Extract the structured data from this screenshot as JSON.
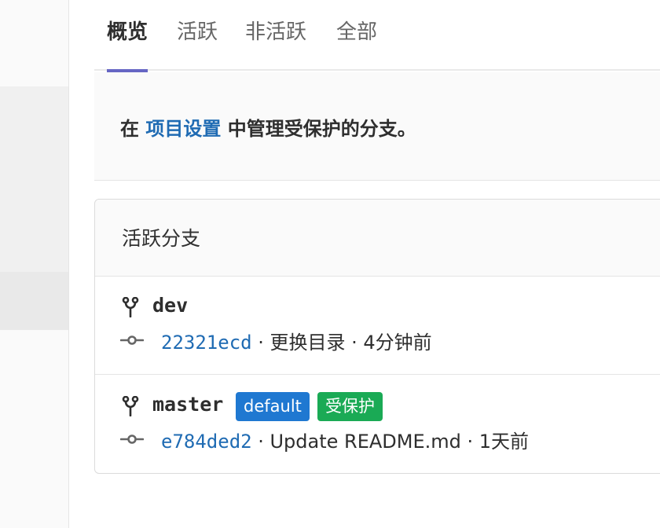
{
  "tabs": [
    {
      "label": "概览",
      "active": true
    },
    {
      "label": "活跃"
    },
    {
      "label": "非活跃"
    },
    {
      "label": "全部"
    }
  ],
  "banner": {
    "prefix": "在 ",
    "link": "项目设置",
    "suffix": " 中管理受保护的分支。"
  },
  "card": {
    "title": "活跃分支",
    "branches": [
      {
        "name": "dev",
        "commit_sha": "22321ecd",
        "commit_message": "更换目录",
        "time": "4分钟前",
        "separator": " · "
      },
      {
        "name": "master",
        "badges": [
          "default",
          "受保护"
        ],
        "commit_sha": "e784ded2",
        "commit_message": "Update README.md",
        "time": "1天前",
        "separator": " · "
      }
    ]
  },
  "colors": {
    "accent": "#6666c4",
    "link": "#1f6bb3",
    "badge_default": "#1f78d1",
    "badge_protected": "#1aaa55"
  },
  "icons": {
    "branch": "branch-icon",
    "commit": "commit-icon"
  }
}
